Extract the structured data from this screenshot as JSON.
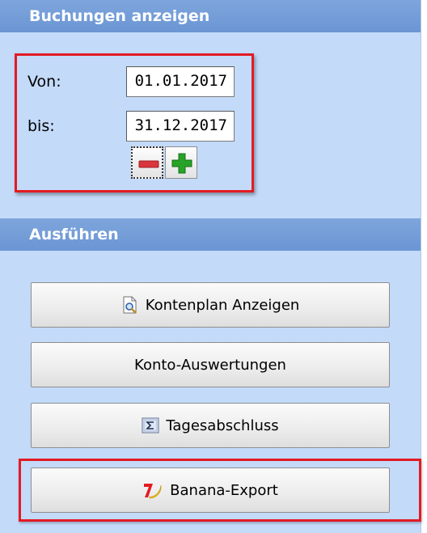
{
  "filter_section": {
    "title": "Buchungen anzeigen",
    "from_label": "Von:",
    "from_value": "01.01.2017",
    "to_label": "bis:",
    "to_value": "31.12.2017"
  },
  "actions_section": {
    "title": "Ausführen",
    "buttons": [
      {
        "label": "Kontenplan Anzeigen",
        "icon": "document-search-icon"
      },
      {
        "label": "Konto-Auswertungen",
        "icon": ""
      },
      {
        "label": "Tagesabschluss",
        "icon": "sigma-icon"
      },
      {
        "label": "Banana-Export",
        "icon": "banana-logo-icon"
      }
    ]
  },
  "colors": {
    "panel_background": "#c3daf9",
    "header_background": "#6b96d4",
    "highlight_border": "#e21b23",
    "minus_red": "#d9363e",
    "plus_green": "#27a327"
  }
}
